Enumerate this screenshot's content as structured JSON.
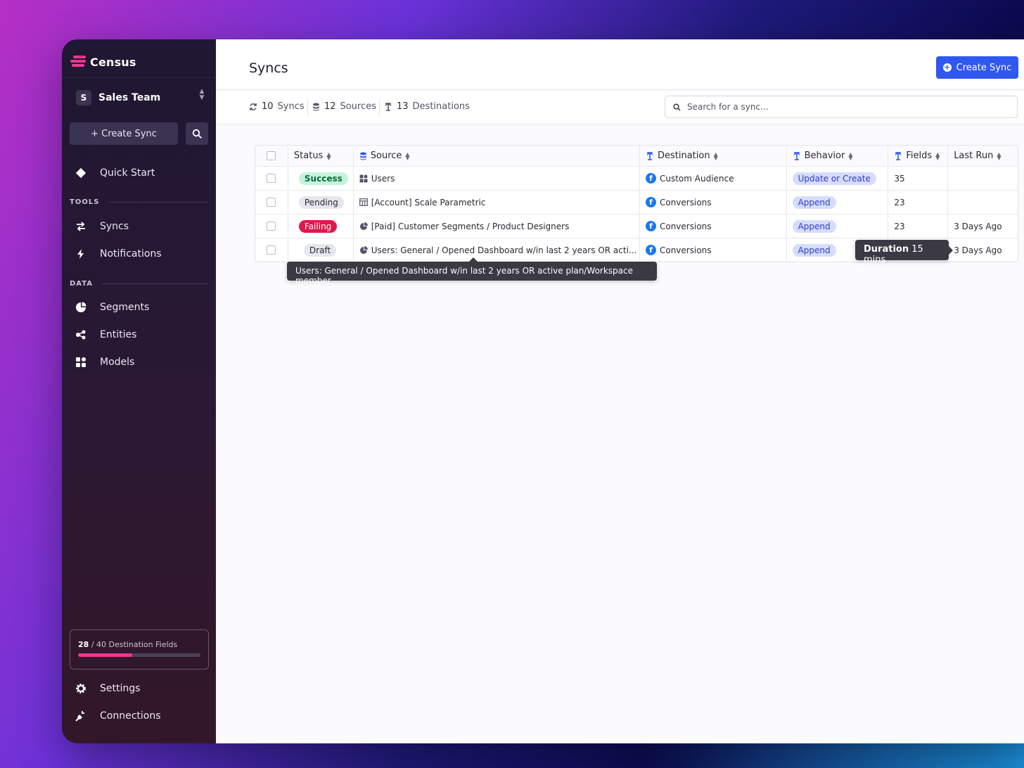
{
  "app": {
    "name": "Census"
  },
  "workspace": {
    "initial": "S",
    "name": "Sales Team"
  },
  "sidebar": {
    "create_label": "+ Create Sync",
    "quick_start": "Quick Start",
    "tools_label": "TOOLS",
    "tools": [
      {
        "label": "Syncs",
        "icon": "arrows-swap-icon"
      },
      {
        "label": "Notifications",
        "icon": "bolt-icon"
      }
    ],
    "data_label": "DATA",
    "data": [
      {
        "label": "Segments",
        "icon": "pie-icon"
      },
      {
        "label": "Entities",
        "icon": "entities-icon"
      },
      {
        "label": "Models",
        "icon": "grid-icon"
      }
    ],
    "usage": {
      "used": "28",
      "total": "/ 40",
      "label": "Destination Fields",
      "fraction": 0.44
    },
    "settings": "Settings",
    "connections": "Connections"
  },
  "header": {
    "title": "Syncs",
    "create_button": "Create Sync"
  },
  "stats": {
    "syncs_num": "10",
    "syncs_label": "Syncs",
    "sources_num": "12",
    "sources_label": "Sources",
    "destinations_num": "13",
    "destinations_label": "Destinations"
  },
  "search": {
    "placeholder": "Search for a sync..."
  },
  "table": {
    "headers": {
      "status": "Status",
      "source": "Source",
      "destination": "Destination",
      "behavior": "Behavior",
      "fields": "Fields",
      "last_run": "Last Run"
    },
    "rows": [
      {
        "status": "Success",
        "source": "Users",
        "destination": "Custom Audience",
        "behavior": "Update or Create",
        "fields": "35",
        "last_run": ""
      },
      {
        "status": "Pending",
        "source": "[Account] Scale Parametric",
        "destination": "Conversions",
        "behavior": "Append",
        "fields": "23",
        "last_run": ""
      },
      {
        "status": "Failing",
        "source": "[Paid] Customer Segments / Product Designers",
        "destination": "Conversions",
        "behavior": "Append",
        "fields": "23",
        "last_run": "3 Days Ago"
      },
      {
        "status": "Draft",
        "source": "Users: General / Opened Dashboard w/in last 2 years OR acti...",
        "destination": "Conversions",
        "behavior": "Append",
        "fields": "",
        "last_run": "3 Days Ago"
      }
    ]
  },
  "tooltips": {
    "source_full": "Users: General / Opened Dashboard w/in last 2 years OR active plan/Workspace member",
    "duration_label": "Duration",
    "duration_value": "15 mins"
  },
  "colors": {
    "accent": "#3057ee",
    "brand": "#f0368f",
    "success": "#c7f3dd",
    "failing": "#e3174e"
  }
}
